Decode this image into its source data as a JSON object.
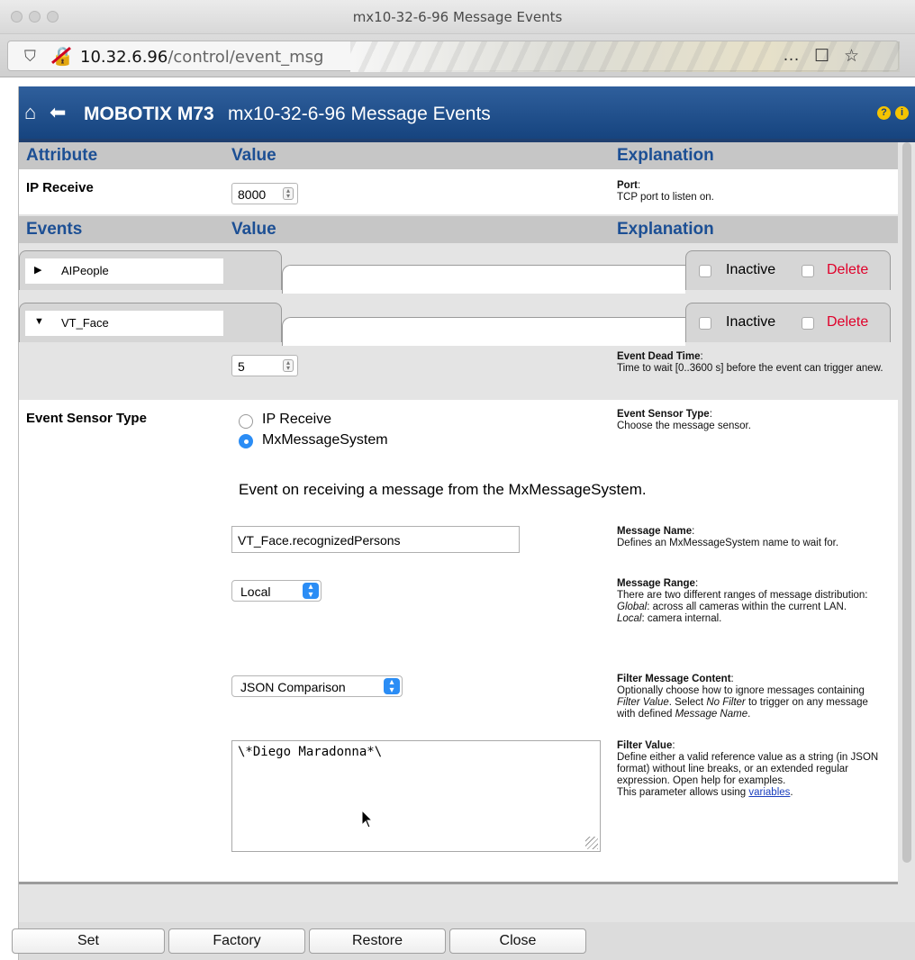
{
  "window": {
    "title": "mx10-32-6-96 Message Events"
  },
  "urlbar": {
    "host": "10.32.6.96",
    "path": "/control/event_msg"
  },
  "header": {
    "brand": "MOBOTIX M73",
    "title": "mx10-32-6-96 Message Events",
    "help": "?",
    "info": "i"
  },
  "attr_header": {
    "col1": "Attribute",
    "col2": "Value",
    "col3": "Explanation"
  },
  "ip_receive": {
    "label": "IP Receive",
    "port_value": "8000",
    "expl_title": "Port",
    "expl_text": "TCP port to listen on."
  },
  "events_header": {
    "col1": "Events",
    "col2": "Value",
    "col3": "Explanation"
  },
  "events": [
    {
      "name": "AIPeople",
      "inactive_label": "Inactive",
      "delete_label": "Delete"
    },
    {
      "name": "VT_Face",
      "inactive_label": "Inactive",
      "delete_label": "Delete"
    }
  ],
  "dead_time": {
    "value": "5",
    "expl_title": "Event Dead Time",
    "expl_text": "Time to wait [0..3600 s] before the event can trigger anew."
  },
  "sensor_type": {
    "label": "Event Sensor Type",
    "options": [
      "IP Receive",
      "MxMessageSystem"
    ],
    "selected": "MxMessageSystem",
    "expl_title": "Event Sensor Type",
    "expl_text": "Choose the message sensor.",
    "description": "Event on receiving a message from the MxMessageSystem."
  },
  "message_name": {
    "value": "VT_Face.recognizedPersons",
    "expl_title": "Message Name",
    "expl_text": "Defines an MxMessageSystem name to wait for."
  },
  "message_range": {
    "value": "Local",
    "expl_title": "Message Range",
    "expl_text": "There are two different ranges of message distribution:",
    "global_term": "Global",
    "global_text": ": across all cameras within the current LAN.",
    "local_term": "Local",
    "local_text": ": camera internal."
  },
  "filter_content": {
    "value": "JSON Comparison",
    "expl_title": "Filter Message Content",
    "expl_text_1": "Optionally choose how to ignore messages containing ",
    "expl_term_1": "Filter Value",
    "expl_text_2": ". Select ",
    "expl_term_2": "No Filter",
    "expl_text_3": " to trigger on any message with defined ",
    "expl_term_3": "Message Name",
    "expl_text_4": "."
  },
  "filter_value": {
    "value": "\\*Diego Maradonna*\\",
    "expl_title": "Filter Value",
    "expl_text": "Define either a valid reference value as a string (in JSON format) without line breaks, or an extended regular expression. Open help for examples.",
    "expl_text_2": "This parameter allows using ",
    "link_text": "variables",
    "expl_text_3": "."
  },
  "footer": {
    "set": "Set",
    "factory": "Factory",
    "restore": "Restore",
    "close": "Close"
  },
  "colors": {
    "header_blue": "#1f4f8f",
    "column_heading": "#1c4f94",
    "delete_red": "#e0002a",
    "radio_selected": "#2b8df5"
  }
}
